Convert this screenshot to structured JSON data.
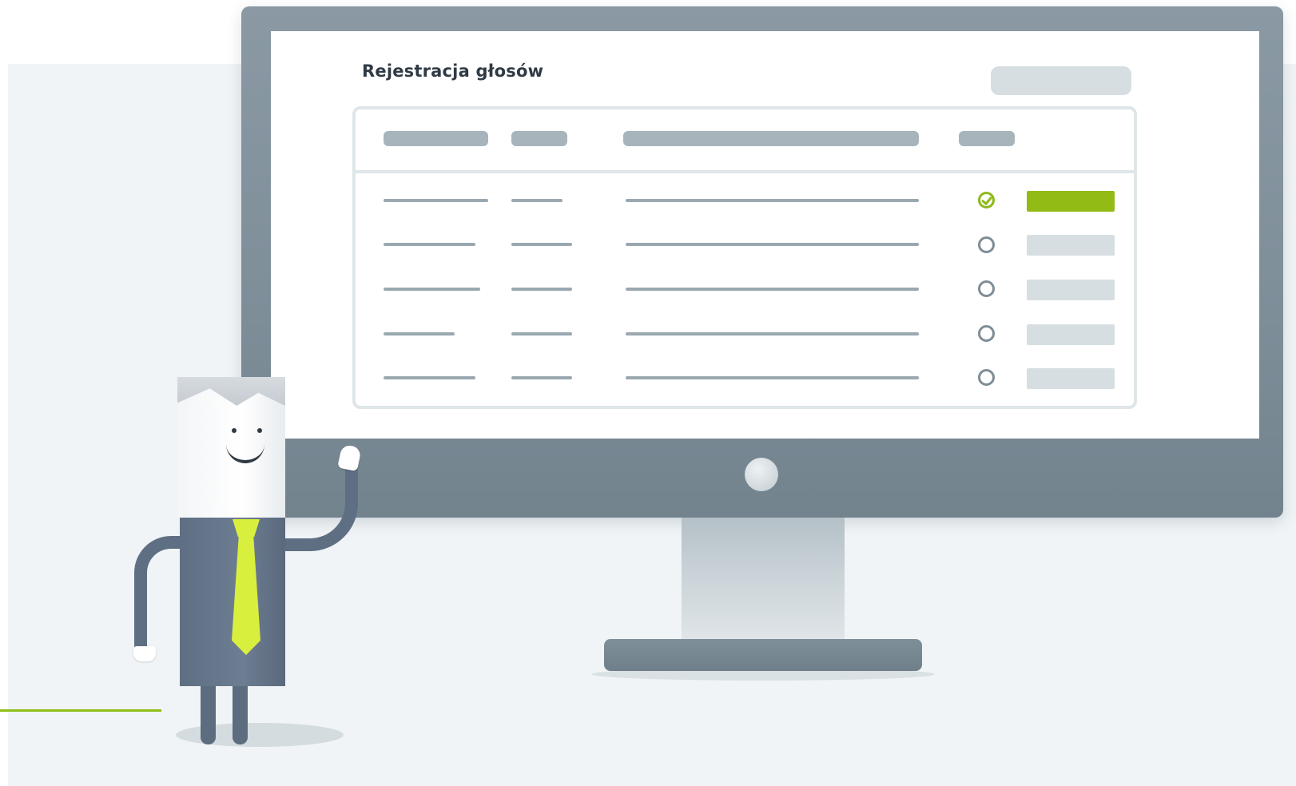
{
  "app": {
    "title": "Rejestracja głosów"
  },
  "table": {
    "row_count": 5,
    "rows": [
      {
        "selected": true
      },
      {
        "selected": false
      },
      {
        "selected": false
      },
      {
        "selected": false
      },
      {
        "selected": false
      }
    ]
  },
  "colors": {
    "accent": "#92bb16",
    "monitor": "#7e8e99",
    "background": "#f0f4f6",
    "tie": "#d9ef3d"
  },
  "icons": {
    "selected": "check-circle-icon",
    "unselected": "radio-empty-icon"
  }
}
